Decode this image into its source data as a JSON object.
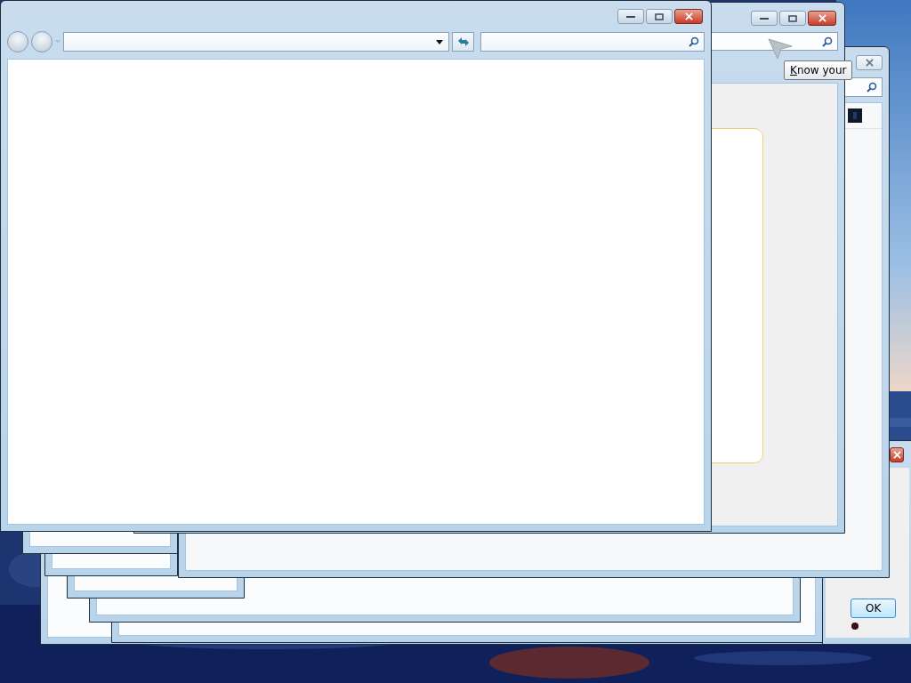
{
  "tooltip": {
    "text": "Know your"
  },
  "dialog": {
    "ok_button": "OK"
  }
}
